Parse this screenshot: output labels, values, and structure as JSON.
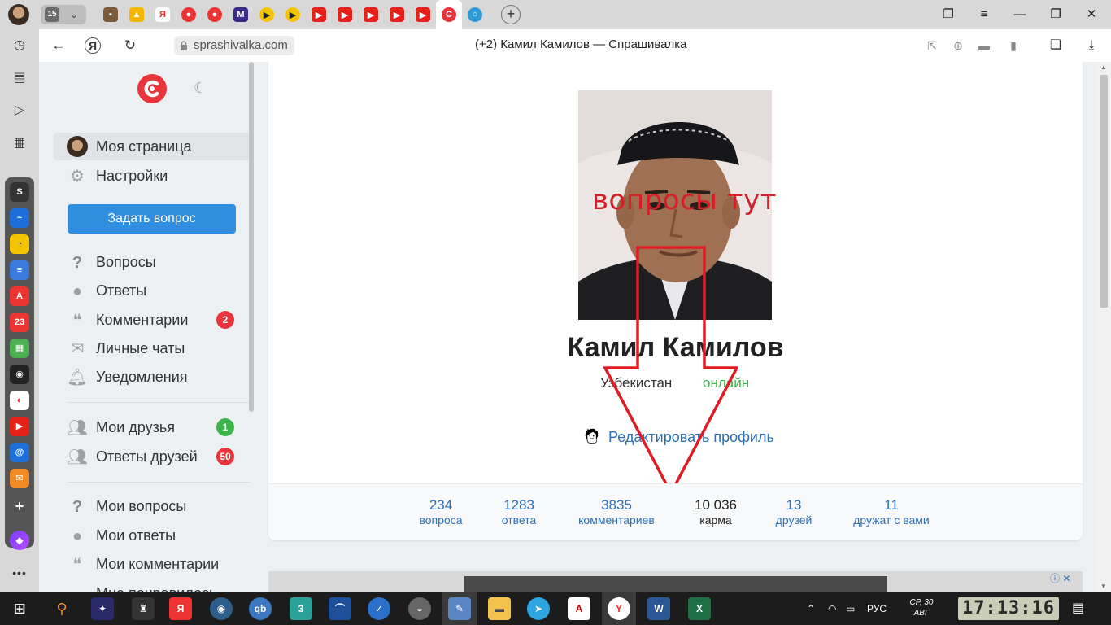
{
  "browser": {
    "tab_count": "15",
    "url": "sprashivalka.com",
    "page_title": "(+2) Камил Камилов — Спрашивалка"
  },
  "taskbar": {
    "language": "РУС",
    "date_line1": "СР, 30",
    "date_line2": "АВГ",
    "clock": "17:13:16"
  },
  "sidebar_apps": {
    "calendar_badge": "23"
  },
  "leftnav": {
    "items_top": [
      {
        "label": "Моя страница"
      },
      {
        "label": "Настройки"
      }
    ],
    "ask_button": "Задать вопрос",
    "items_main": [
      {
        "label": "Вопросы"
      },
      {
        "label": "Ответы"
      },
      {
        "label": "Комментарии",
        "badge": "2"
      },
      {
        "label": "Личные чаты"
      },
      {
        "label": "Уведомления"
      }
    ],
    "items_friends": [
      {
        "label": "Мои друзья",
        "badge": "1"
      },
      {
        "label": "Ответы друзей",
        "badge": "50"
      }
    ],
    "items_mine": [
      {
        "label": "Мои вопросы"
      },
      {
        "label": "Мои ответы"
      },
      {
        "label": "Мои комментарии"
      },
      {
        "label": "Мне понравилось"
      }
    ]
  },
  "profile": {
    "name": "Камил Камилов",
    "country": "Узбекистан",
    "status": "онлайн",
    "edit_label": "Редактировать профиль",
    "stats": [
      {
        "value": "234",
        "label": "вопроса"
      },
      {
        "value": "1283",
        "label": "ответа"
      },
      {
        "value": "3835",
        "label": "комментариев"
      },
      {
        "value": "10 036",
        "label": "карма"
      },
      {
        "value": "13",
        "label": "друзей"
      },
      {
        "value": "11",
        "label": "дружат с вами"
      }
    ]
  },
  "annotation": {
    "text": "вопросы тут"
  },
  "colors": {
    "brand_red": "#e8343b",
    "accent_blue": "#2f8ee0",
    "link_blue": "#2b6fb8",
    "online_green": "#3bb54a",
    "badge_red": "#e8343b",
    "badge_green": "#3bb54a",
    "annotation_red": "#d71f2a"
  }
}
